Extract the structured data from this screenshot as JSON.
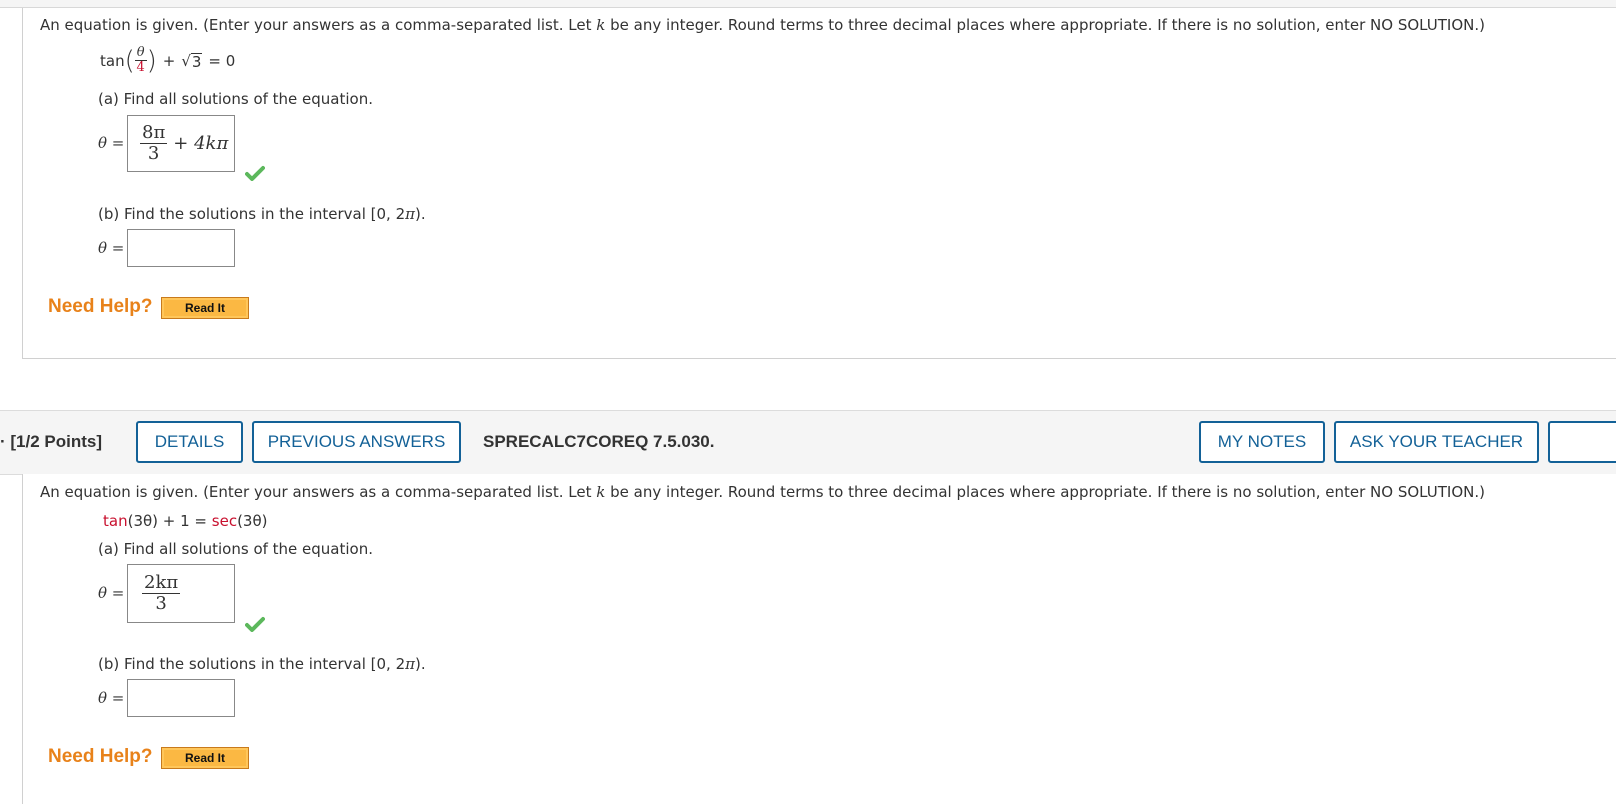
{
  "instructions": {
    "prefix": "An equation is given. (Enter your answers as a comma-separated list. Let ",
    "k": "k",
    "suffix": " be any integer. Round terms to three decimal places where appropriate. If there is no solution, enter NO SOLUTION.)"
  },
  "question1": {
    "equation": {
      "func": "tan",
      "frac_num": "θ",
      "frac_den": "4",
      "plus": "+",
      "sqrt_symbol": "√",
      "sqrt_val": "3",
      "rhs": "= 0"
    },
    "part_a": {
      "label": "(a) Find all solutions of the equation.",
      "theta_label": "θ =",
      "answer": {
        "frac_num": "8π",
        "frac_den": "3",
        "tail": "+ 4kπ"
      },
      "status": "correct"
    },
    "part_b": {
      "label_prefix": "(b) Find the solutions in the interval [0, 2",
      "pi": "π",
      "label_suffix": ").",
      "theta_label": "θ =",
      "answer": ""
    },
    "help": {
      "need_help": "Need Help?",
      "read_it": "Read It"
    }
  },
  "question_bar": {
    "points": "· [1/2 Points]",
    "details": "DETAILS",
    "previous_answers": "PREVIOUS ANSWERS",
    "question_id": "SPRECALC7COREQ 7.5.030.",
    "my_notes": "MY NOTES",
    "ask_teacher": "ASK YOUR TEACHER"
  },
  "question2": {
    "equation": {
      "tan": "tan",
      "tan_arg": "(3θ) + 1 = ",
      "sec": "sec",
      "sec_arg": "(3θ)"
    },
    "part_a": {
      "label": "(a) Find all solutions of the equation.",
      "theta_label": "θ =",
      "answer": {
        "frac_num": "2kπ",
        "frac_den": "3"
      },
      "status": "correct"
    },
    "part_b": {
      "label_prefix": "(b) Find the solutions in the interval [0, 2",
      "pi": "π",
      "label_suffix": ").",
      "theta_label": "θ =",
      "answer": ""
    },
    "help": {
      "need_help": "Need Help?",
      "read_it": "Read It"
    }
  },
  "colors": {
    "accent_blue": "#136197",
    "help_orange": "#e8821a",
    "read_it_bg": "#fbb843",
    "correct_green": "#5cb85c",
    "function_red": "#c8102e"
  }
}
